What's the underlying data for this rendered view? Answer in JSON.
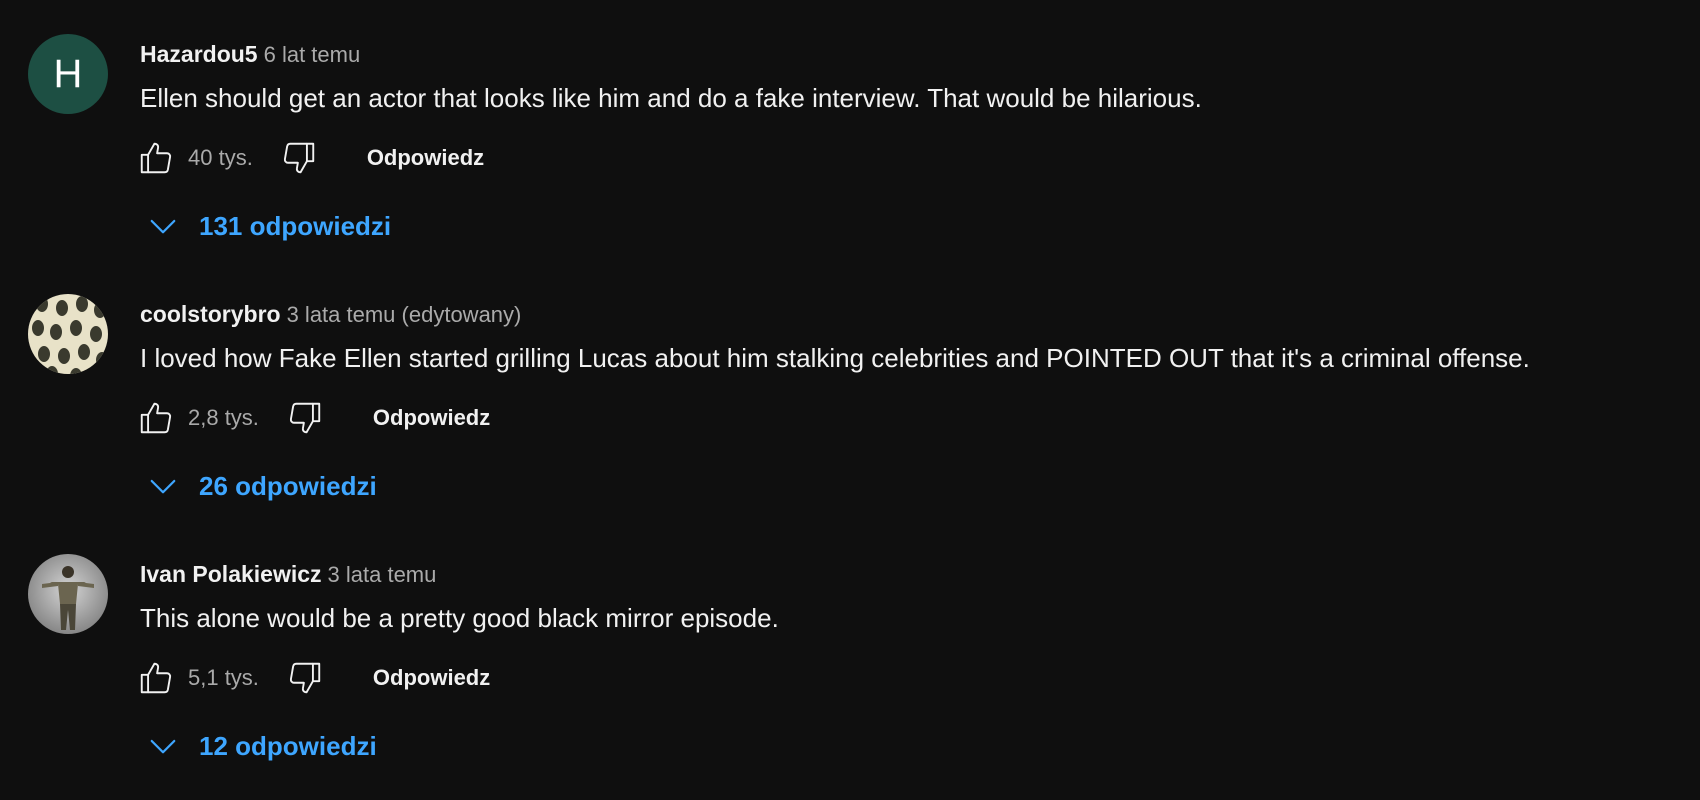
{
  "colors": {
    "background": "#0f0f0f",
    "text_primary": "#f1f1f1",
    "text_secondary": "#aaaaaa",
    "link_blue": "#3ea6ff",
    "avatar_h_bg": "#1d4f43"
  },
  "comments": [
    {
      "avatar_letter": "H",
      "author": "Hazardou5",
      "time": "6 lat temu",
      "text": "Ellen should get an actor that looks like him and do a fake interview. That would be hilarious.",
      "likes": "40 tys.",
      "reply_label": "Odpowiedz",
      "replies_label": "131 odpowiedzi",
      "icons": [
        "thumbs-up-icon",
        "thumbs-down-icon",
        "chevron-down-icon"
      ]
    },
    {
      "avatar_letter": "",
      "author": "coolstorybro",
      "time": "3 lata temu (edytowany)",
      "text": "I loved how Fake Ellen started grilling Lucas about him stalking celebrities and POINTED OUT that it's a criminal offense.",
      "likes": "2,8 tys.",
      "reply_label": "Odpowiedz",
      "replies_label": "26 odpowiedzi",
      "icons": [
        "thumbs-up-icon",
        "thumbs-down-icon",
        "chevron-down-icon"
      ]
    },
    {
      "avatar_letter": "",
      "author": "Ivan Polakiewicz",
      "time": "3 lata temu",
      "text": "This alone would be a pretty good black mirror episode.",
      "likes": "5,1 tys.",
      "reply_label": "Odpowiedz",
      "replies_label": "12 odpowiedzi",
      "icons": [
        "thumbs-up-icon",
        "thumbs-down-icon",
        "chevron-down-icon"
      ]
    }
  ]
}
